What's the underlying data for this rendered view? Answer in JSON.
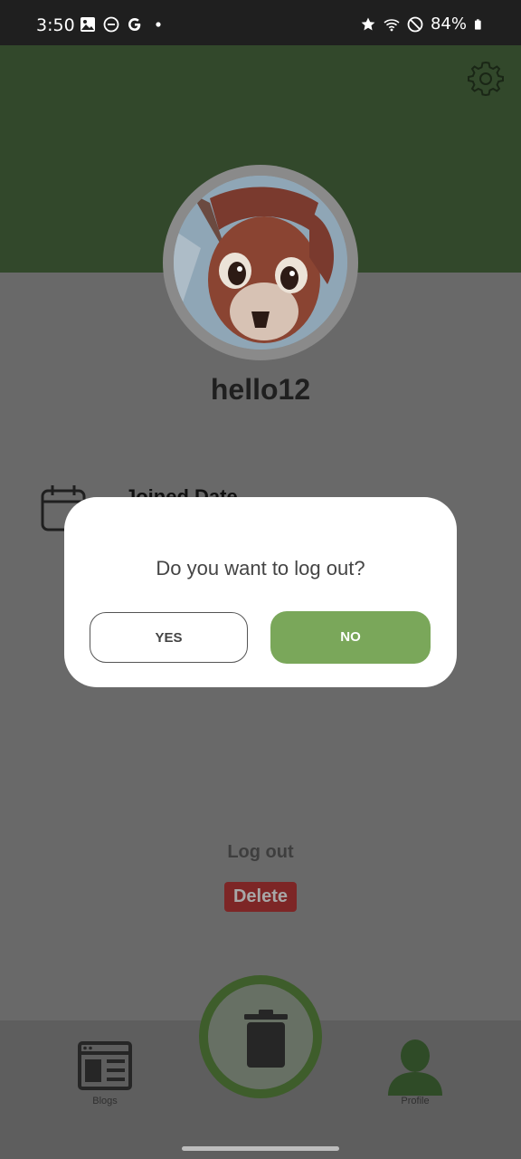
{
  "status_bar": {
    "time": "3:50",
    "battery": "84%",
    "left_icons": [
      "image-icon",
      "do-not-disturb-icon",
      "google-icon",
      "dot-icon"
    ],
    "right_icons": [
      "star-icon",
      "wifi-icon",
      "blocked-icon",
      "battery-icon"
    ]
  },
  "profile": {
    "username": "hello12",
    "joined_label": "Joined Date"
  },
  "actions": {
    "logout_label": "Log out",
    "delete_label": "Delete"
  },
  "dialog": {
    "message": "Do you want to log out?",
    "yes_label": "YES",
    "no_label": "NO"
  },
  "nav": {
    "blogs_label": "Blogs",
    "profile_label": "Profile"
  },
  "colors": {
    "header": "#32482b",
    "accent_green": "#7aa75a",
    "delete_red": "#7d2626",
    "overlay": "#696969"
  }
}
